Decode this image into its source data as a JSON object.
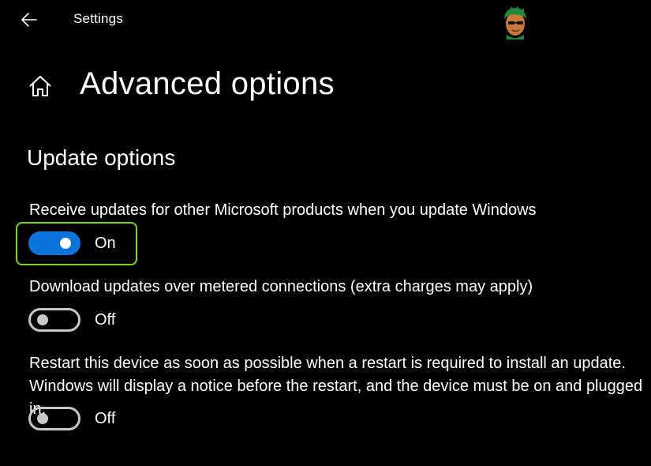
{
  "window": {
    "app_title": "Settings",
    "back_icon": "back-arrow-icon"
  },
  "header": {
    "home_icon": "home-icon",
    "title": "Advanced options"
  },
  "section": {
    "heading": "Update options"
  },
  "settings": [
    {
      "label": "Receive updates for other Microsoft products when you update Windows",
      "state": "On",
      "enabled": true
    },
    {
      "label": "Download updates over metered connections (extra charges may apply)",
      "state": "Off",
      "enabled": false
    },
    {
      "label": "Restart this device as soon as possible when a restart is required to install an update. Windows will display a notice before the restart, and the device must be on and plugged in.",
      "state": "Off",
      "enabled": false
    }
  ],
  "colors": {
    "background": "#000000",
    "text": "#ffffff",
    "toggle_on": "#0a74da",
    "toggle_off_border": "#c8c8c8",
    "highlight": "#7ed321"
  }
}
